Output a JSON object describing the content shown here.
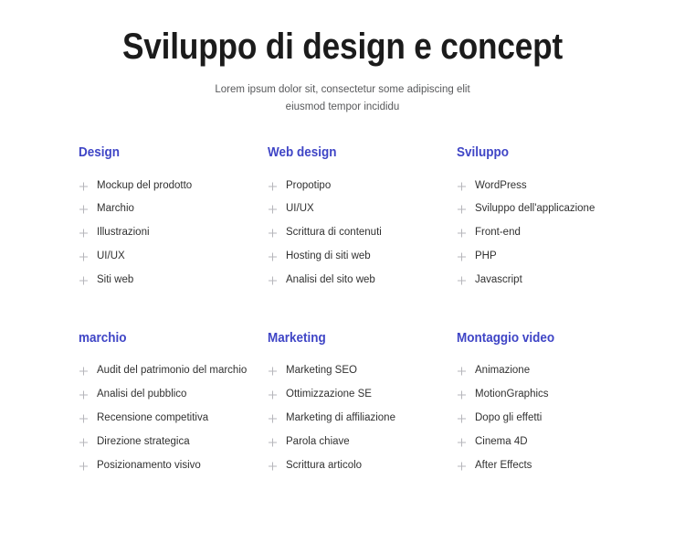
{
  "header": {
    "title": "Sviluppo di design e concept",
    "subtitle_line1": "Lorem ipsum dolor sit, consectetur some adipiscing elit",
    "subtitle_line2": "eiusmod tempor incididu"
  },
  "colors": {
    "background": "#ffffff",
    "title": "#1b1b1b",
    "subtitle": "#58595b",
    "category_heading": "#3f45c6",
    "item_text": "#313131",
    "plus_icon": "#b6b6bb"
  },
  "icons": {
    "bullet": "plus-icon"
  },
  "categories": [
    {
      "title": "Design",
      "items": [
        "Mockup del prodotto",
        "Marchio",
        "Illustrazioni",
        "UI/UX",
        "Siti web"
      ]
    },
    {
      "title": "Web design",
      "items": [
        "Propotipo",
        "UI/UX",
        "Scrittura di contenuti",
        "Hosting di siti web",
        "Analisi del sito web"
      ]
    },
    {
      "title": "Sviluppo",
      "items": [
        "WordPress",
        "Sviluppo dell'applicazione",
        "Front-end",
        "PHP",
        "Javascript"
      ]
    },
    {
      "title": "marchio",
      "items": [
        "Audit del patrimonio del marchio",
        "Analisi del pubblico",
        "Recensione competitiva",
        "Direzione strategica",
        "Posizionamento visivo"
      ]
    },
    {
      "title": "Marketing",
      "items": [
        "Marketing SEO",
        "Ottimizzazione SE",
        "Marketing di affiliazione",
        "Parola chiave",
        "Scrittura articolo"
      ]
    },
    {
      "title": "Montaggio video",
      "items": [
        "Animazione",
        "MotionGraphics",
        "Dopo gli effetti",
        "Cinema 4D",
        "After Effects"
      ]
    }
  ]
}
